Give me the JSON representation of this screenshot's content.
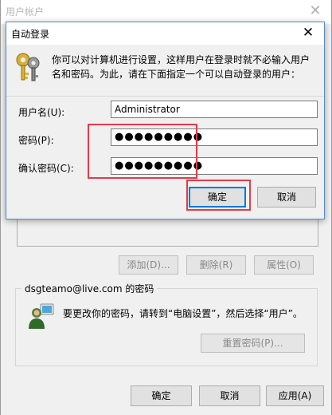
{
  "back_window": {
    "title": "用户帐户",
    "close_glyph": "✕",
    "buttons": {
      "add": "添加(D)...",
      "remove": "删除(R)",
      "properties": "属性(O)"
    },
    "password_group": {
      "title": "dsgteamo@live.com 的密码",
      "text": "要更改你的密码，请转到“电脑设置”，然后选择“用户”。",
      "reset_button": "重置密码(P)...",
      "icon": "user-icon"
    },
    "footer": {
      "ok": "确定",
      "cancel": "取消",
      "apply": "应用(A)"
    }
  },
  "dialog": {
    "title": "自动登录",
    "close_glyph": "✕",
    "icon": "keys-icon",
    "description": "你可以对计算机进行设置，这样用户在登录时就不必输入用户名和密码。为此，请在下面指定一个可以自动登录的用户：",
    "fields": {
      "username_label": "用户名(U):",
      "username_value": "Administrator",
      "password_label": "密码(P):",
      "password_value": "●●●●●●●●●",
      "confirm_label": "确认密码(C):",
      "confirm_value": "●●●●●●●●●"
    },
    "ok": "确定",
    "cancel": "取消"
  },
  "colors": {
    "highlight": "#e53a4a",
    "focus": "#0078d7"
  }
}
